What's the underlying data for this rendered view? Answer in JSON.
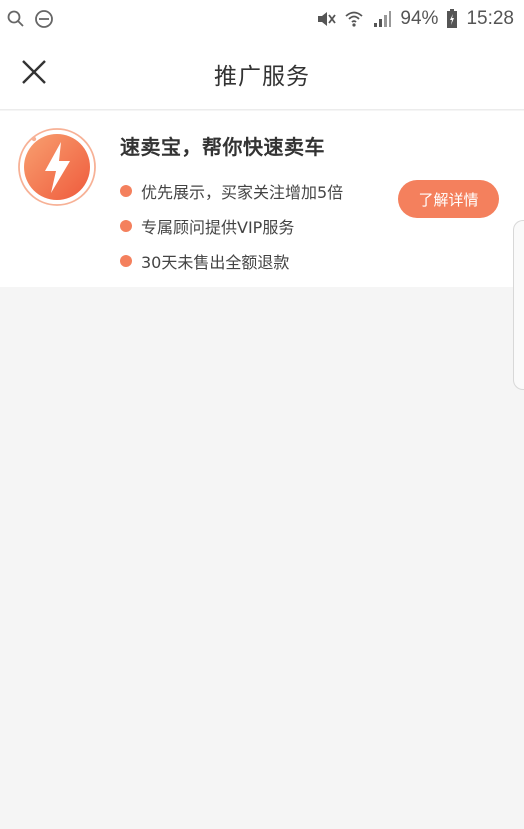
{
  "status_bar": {
    "battery": "94%",
    "time": "15:28",
    "icons": [
      "search-icon",
      "do-not-disturb-icon",
      "mute-icon",
      "wifi-icon",
      "signal-icon",
      "battery-icon"
    ]
  },
  "header": {
    "title": "推广服务",
    "close_icon": "close-icon"
  },
  "promo": {
    "logo_icon": "lightning-icon",
    "title": "速卖宝，帮你快速卖车",
    "features": [
      "优先展示，买家关注增加5倍",
      "专属顾问提供VIP服务",
      "30天未售出全额退款"
    ],
    "button_label": "了解详情"
  },
  "colors": {
    "accent": "#f4805d",
    "background": "#f5f5f5",
    "card": "#ffffff",
    "text": "#333333"
  }
}
